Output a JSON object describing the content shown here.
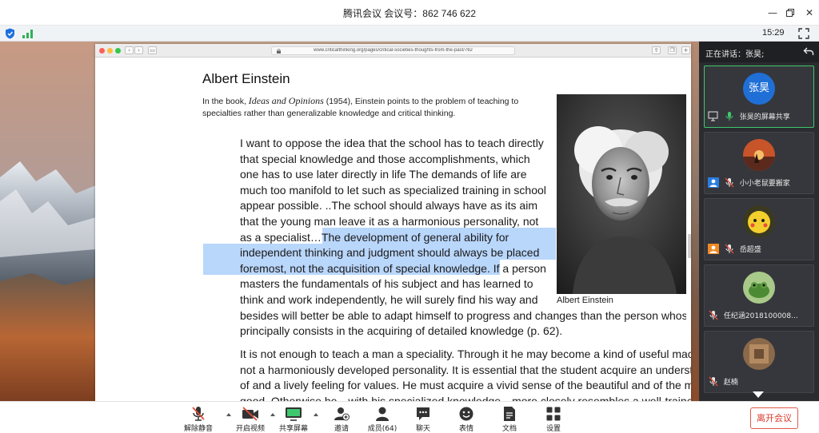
{
  "titlebar": {
    "title": "腾讯会议 会议号：862 746 622"
  },
  "statusbar": {
    "time": "15:29"
  },
  "browser": {
    "url": "www.criticalthinking.org/pages/critical-societies-thoughts-from-the-past/762",
    "heading": "Albert Einstein",
    "intro_prefix": "In the book, ",
    "intro_book": "Ideas and Opinions",
    "intro_suffix": " (1954), Einstein points to the problem of teaching to",
    "intro_line2": "specialties rather than generalizable knowledge and critical thinking.",
    "quote_lines": [
      "I want to oppose the idea that the school has to teach directly",
      "that special knowledge and those accomplishments, which",
      "one has to use later directly in life The demands of life are",
      "much too manifold to let such as specialized training in school",
      "appear possible. ..The school should always have as its aim",
      "that the young man leave it as a harmonious personality, not"
    ],
    "quote_line7_pre": "as a specialist…",
    "quote_line7_hl": "The development of general ability for",
    "quote_line8_hl": "independent thinking and judgment should always be placed",
    "quote_line9_hl": "foremost, not the acquisition of special knowledge.",
    "quote_line9_post": " If a person",
    "quote_tail": [
      "masters the fundamentals of his subject and has learned to",
      "think and work independently, he will surely find his way and",
      "besides will better be able to adapt himself to progress and changes than the person whose training",
      "principally consists in the acquiring of detailed knowledge (p. 62)."
    ],
    "para2_lines": [
      "It is not enough to teach a man a speciality. Through it he may become a kind of useful machine but",
      "not a harmoniously developed personality. It is essential that the student acquire an understanding",
      "of and a lively feeling for values. He must acquire a vivid sense of the beautiful and of the morally",
      "good. Otherwise he—with his specialized knowledge—more closely resembles a well-trained dog"
    ],
    "photo_caption": "Albert Einstein"
  },
  "panel": {
    "speaking_label": "正在讲话：张昊;",
    "participants": [
      {
        "avatar_text": "张昊",
        "name": "张昊的屏幕共享"
      },
      {
        "avatar_text": "",
        "name": "小小老鼠要搬家"
      },
      {
        "avatar_text": "",
        "name": "岳超盛"
      },
      {
        "avatar_text": "",
        "name": "任纪涵2018100008..."
      },
      {
        "avatar_text": "",
        "name": "赵楠"
      }
    ]
  },
  "toolbar": {
    "unmute": "解除静音",
    "video": "开启视频",
    "share": "共享屏幕",
    "invite": "邀请",
    "members": "成员(64)",
    "chat": "聊天",
    "reaction": "表情",
    "docs": "文档",
    "settings": "设置",
    "leave": "离开会议"
  },
  "colors": {
    "accent_green": "#3ec86e",
    "leave_red": "#d9392a",
    "highlight": "#b9d6fb"
  }
}
